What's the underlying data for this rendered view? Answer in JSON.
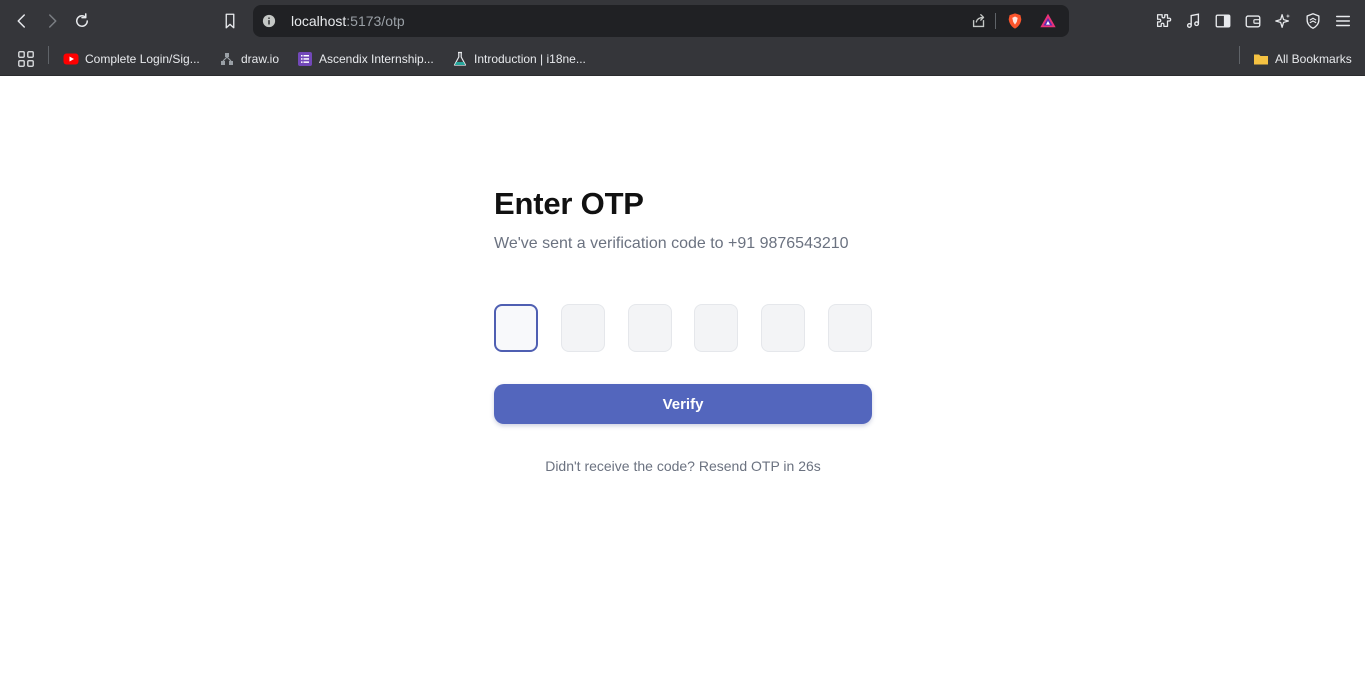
{
  "browser": {
    "url_host": "localhost",
    "url_path": ":5173/otp",
    "bookmarks": [
      {
        "label": "Complete Login/Sig...",
        "icon": "youtube-icon"
      },
      {
        "label": "draw.io",
        "icon": "drawio-icon"
      },
      {
        "label": "Ascendix Internship...",
        "icon": "form-icon"
      },
      {
        "label": "Introduction | i18ne...",
        "icon": "flask-icon"
      }
    ],
    "all_bookmarks": "All Bookmarks"
  },
  "page": {
    "title": "Enter OTP",
    "subtitle": "We've sent a verification code to +91 9876543210",
    "otp_digits": [
      "",
      "",
      "",
      "",
      "",
      ""
    ],
    "verify_label": "Verify",
    "resend_text": "Didn't receive the code? Resend OTP in 26s"
  },
  "colors": {
    "accent": "#5366bd",
    "chrome_bg": "#35363a",
    "omnibox_bg": "#202124"
  }
}
